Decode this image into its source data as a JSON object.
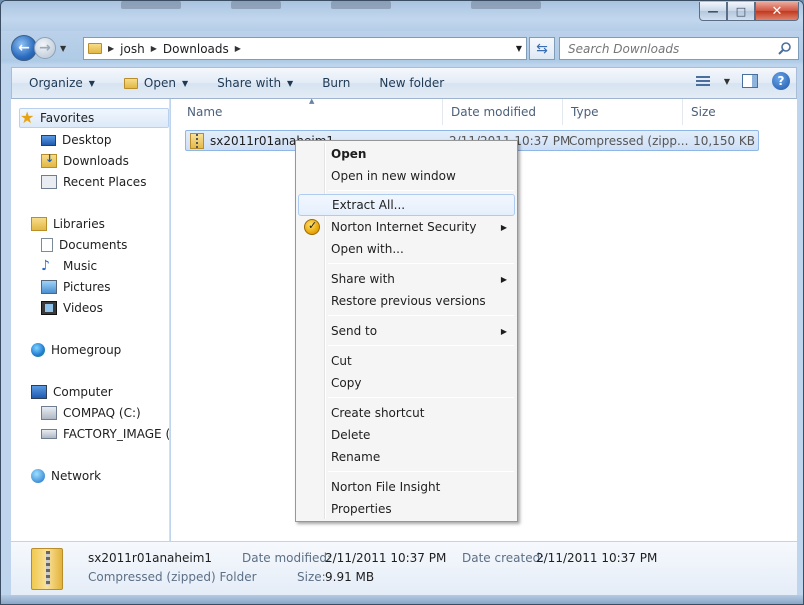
{
  "window": {
    "minimize_glyph": "—",
    "maximize_glyph": "□",
    "close_glyph": "✕"
  },
  "nav": {
    "breadcrumbs": [
      "josh",
      "Downloads"
    ],
    "search_placeholder": "Search Downloads"
  },
  "toolbar": {
    "organize": "Organize",
    "open": "Open",
    "share_with": "Share with",
    "burn": "Burn",
    "new_folder": "New folder",
    "help": "?"
  },
  "sidebar": {
    "favorites": "Favorites",
    "desktop": "Desktop",
    "downloads": "Downloads",
    "recent_places": "Recent Places",
    "libraries": "Libraries",
    "documents": "Documents",
    "music": "Music",
    "pictures": "Pictures",
    "videos": "Videos",
    "homegroup": "Homegroup",
    "computer": "Computer",
    "drive_c": "COMPAQ (C:)",
    "drive_d": "FACTORY_IMAGE (D",
    "network": "Network"
  },
  "columns": {
    "name": "Name",
    "date_modified": "Date modified",
    "type": "Type",
    "size": "Size"
  },
  "files": [
    {
      "name": "sx2011r01anaheim1",
      "date_modified": "2/11/2011 10:37 PM",
      "type": "Compressed (zipp...",
      "size": "10,150 KB"
    }
  ],
  "context_menu": {
    "open": "Open",
    "open_new_window": "Open in new window",
    "extract_all": "Extract All...",
    "norton_security": "Norton Internet Security",
    "open_with": "Open with...",
    "share_with": "Share with",
    "restore_prev": "Restore previous versions",
    "send_to": "Send to",
    "cut": "Cut",
    "copy": "Copy",
    "create_shortcut": "Create shortcut",
    "delete": "Delete",
    "rename": "Rename",
    "norton_insight": "Norton File Insight",
    "properties": "Properties"
  },
  "details": {
    "name": "sx2011r01anaheim1",
    "type": "Compressed (zipped) Folder",
    "date_modified_label": "Date modified:",
    "date_modified": "2/11/2011 10:37 PM",
    "date_created_label": "Date created:",
    "date_created": "2/11/2011 10:37 PM",
    "size_label": "Size:",
    "size": "9.91 MB"
  }
}
